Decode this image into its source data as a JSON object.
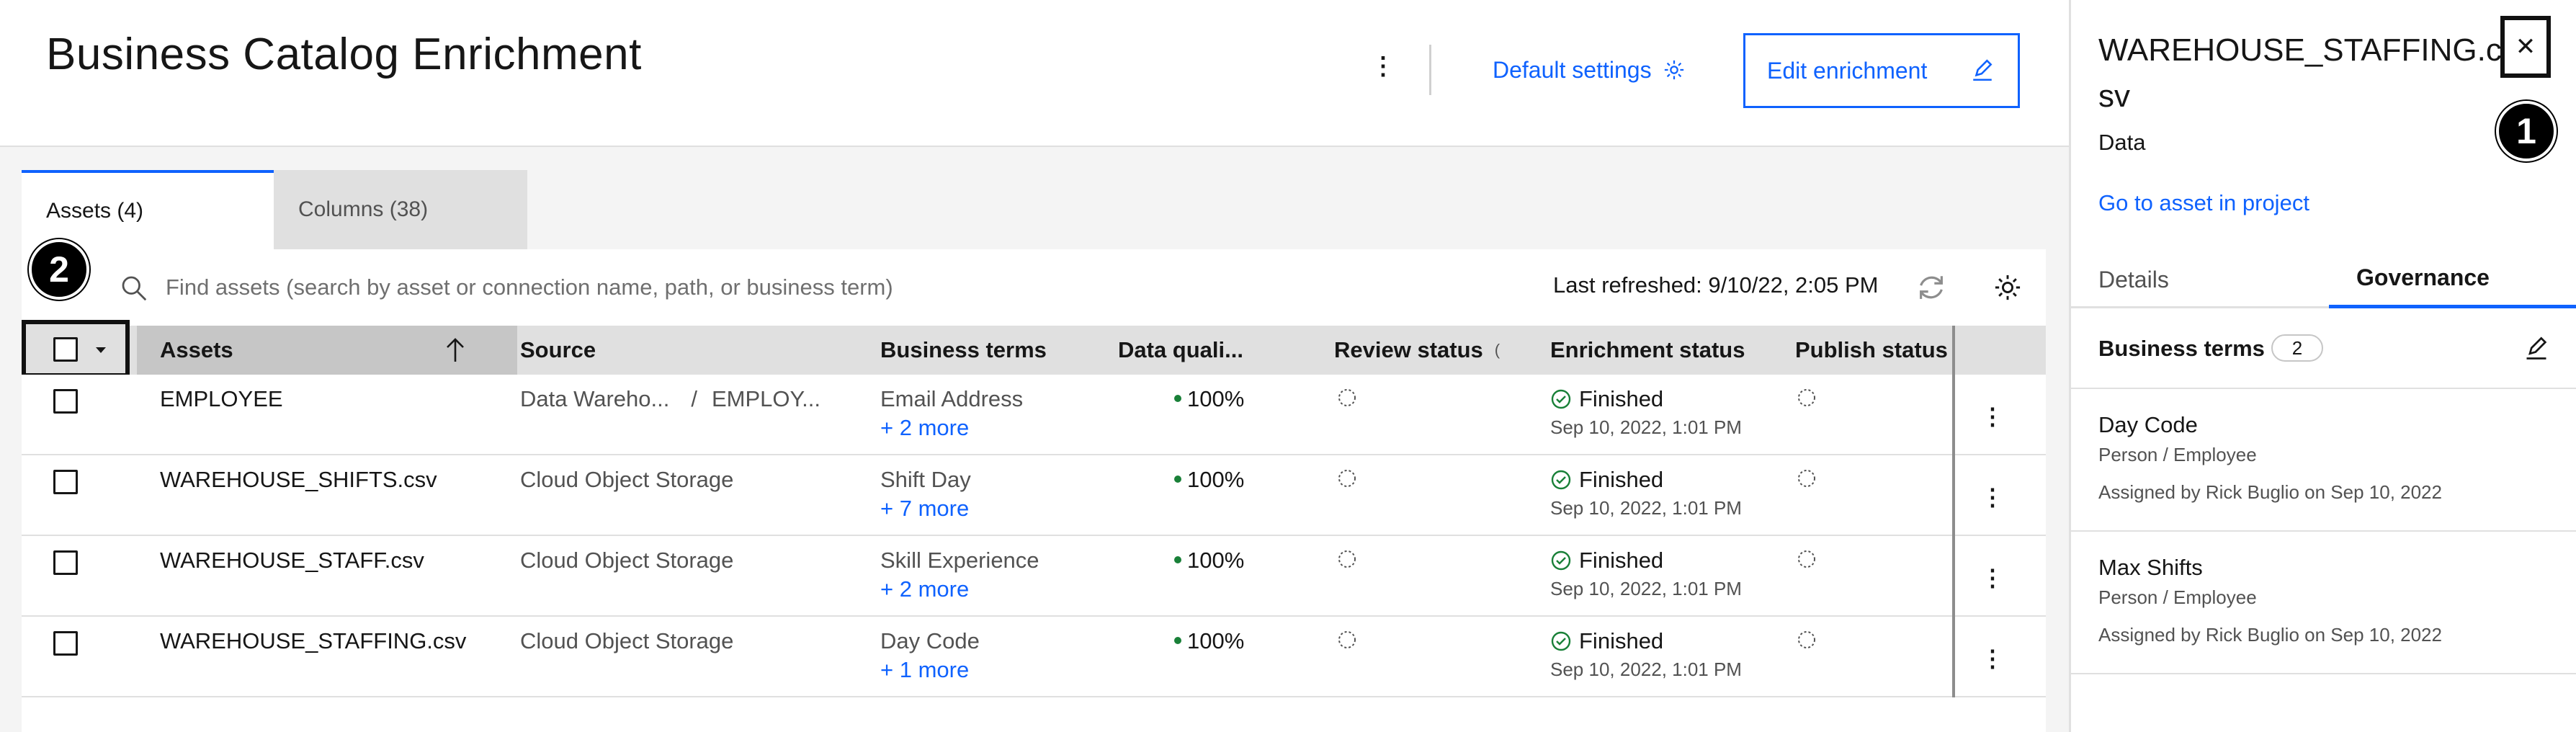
{
  "header": {
    "title": "Business Catalog Enrichment",
    "overflow_icon": "overflow-menu-vertical-icon",
    "default_settings_label": "Default settings",
    "edit_enrichment_label": "Edit enrichment"
  },
  "tabs": [
    {
      "label": "Assets (4)",
      "active": true
    },
    {
      "label": "Columns (38)",
      "active": false
    }
  ],
  "toolbar": {
    "search_placeholder": "Find assets (search by asset or connection name, path, or business term)",
    "last_refreshed": "Last refreshed: 9/10/22, 2:05 PM"
  },
  "table": {
    "columns": {
      "assets": "Assets",
      "source": "Source",
      "business_terms": "Business terms",
      "data_quality": "Data quali...",
      "review_status": "Review status",
      "enrichment_status": "Enrichment status",
      "publish_status": "Publish status"
    },
    "rows": [
      {
        "asset": "EMPLOYEE",
        "source_a": "Data Wareho...",
        "source_sep": "/",
        "source_b": "EMPLOY...",
        "term": "Email Address",
        "more": "+ 2 more",
        "quality": "100%",
        "status": "Finished",
        "date": "Sep 10, 2022, 1:01 PM"
      },
      {
        "asset": "WAREHOUSE_SHIFTS.csv",
        "source_a": "Cloud Object Storage",
        "source_sep": "",
        "source_b": "",
        "term": "Shift Day",
        "more": "+ 7 more",
        "quality": "100%",
        "status": "Finished",
        "date": "Sep 10, 2022, 1:01 PM"
      },
      {
        "asset": "WAREHOUSE_STAFF.csv",
        "source_a": "Cloud Object Storage",
        "source_sep": "",
        "source_b": "",
        "term": "Skill Experience",
        "more": "+ 2 more",
        "quality": "100%",
        "status": "Finished",
        "date": "Sep 10, 2022, 1:01 PM"
      },
      {
        "asset": "WAREHOUSE_STAFFING.csv",
        "source_a": "Cloud Object Storage",
        "source_sep": "",
        "source_b": "",
        "term": "Day Code",
        "more": "+ 1 more",
        "quality": "100%",
        "status": "Finished",
        "date": "Sep 10, 2022, 1:01 PM"
      }
    ]
  },
  "side_panel": {
    "title": "WAREHOUSE_STAFFING.csv",
    "type": "Data",
    "go_to_asset": "Go to asset in project",
    "tabs": [
      "Details",
      "Governance"
    ],
    "active_tab": "Governance",
    "business_terms_label": "Business terms",
    "business_terms_count": "2",
    "terms": [
      {
        "name": "Day Code",
        "path": "Person / Employee",
        "assigned": "Assigned by Rick Buglio on Sep 10, 2022"
      },
      {
        "name": "Max Shifts",
        "path": "Person / Employee",
        "assigned": "Assigned by Rick Buglio on Sep 10, 2022"
      }
    ]
  },
  "callouts": {
    "one": "1",
    "two": "2"
  },
  "colors": {
    "accent": "#0f62fe",
    "success": "#198038",
    "callout": "#000000"
  }
}
